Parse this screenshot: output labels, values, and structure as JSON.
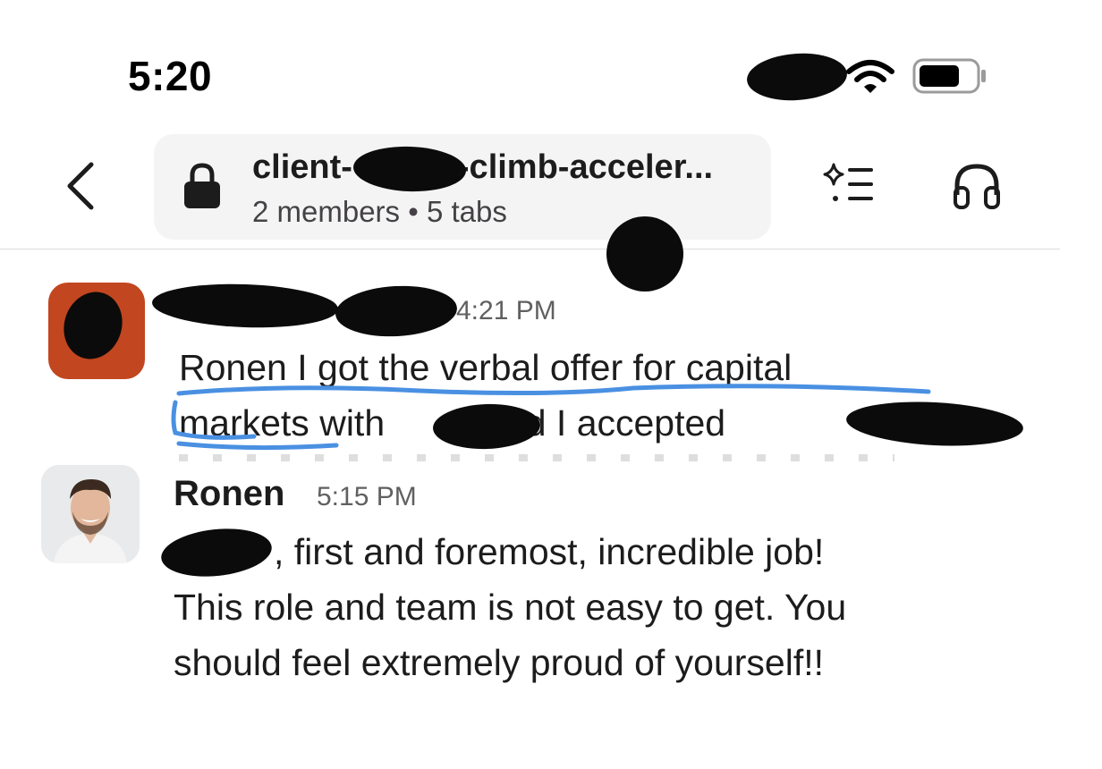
{
  "status_bar": {
    "time": "5:20"
  },
  "header": {
    "back_icon": "chevron-left-icon",
    "channel": {
      "lock_icon": "lock-icon",
      "name_start": "client-",
      "name_end": "-climb-acceler...",
      "members": "2 members",
      "separator": "•",
      "tabs": "5 tabs"
    },
    "actions": {
      "summary_icon": "sparkle-list-icon",
      "huddle_icon": "headphones-icon"
    }
  },
  "messages": [
    {
      "time": "4:21 PM",
      "avatar_color": "#c2461f",
      "line1": "Ronen I got the verbal offer for capital",
      "line2_a": "markets",
      "line2_b": " with",
      "line2_c": "and I accepted",
      "highlight_color": "#4a90e2"
    },
    {
      "sender": "Ronen",
      "time": "5:15 PM",
      "line1": ", first and foremost, incredible job!",
      "line2": "This role and team is not easy to get. You",
      "line3": "should feel extremely proud of yourself!!"
    }
  ]
}
